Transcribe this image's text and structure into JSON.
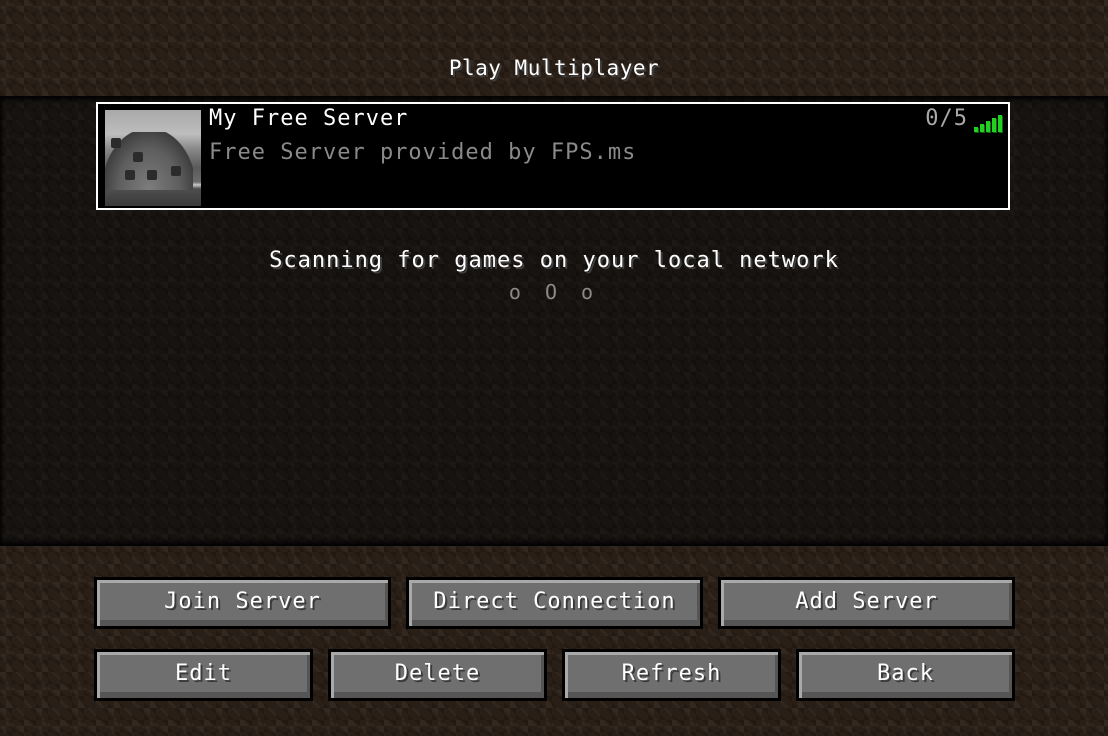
{
  "screen": {
    "title": "Play Multiplayer"
  },
  "servers": [
    {
      "name": "My Free Server",
      "motd": "Free Server provided by FPS.ms",
      "players": "0/5",
      "ping_icon": "signal-bars-icon",
      "ping_color": "#22d022"
    }
  ],
  "lan": {
    "scanning_text": "Scanning for games on your local network",
    "animation": "o O o"
  },
  "buttons": {
    "join_server": "Join Server",
    "direct_connection": "Direct Connection",
    "add_server": "Add Server",
    "edit": "Edit",
    "delete": "Delete",
    "refresh": "Refresh",
    "back": "Back"
  }
}
